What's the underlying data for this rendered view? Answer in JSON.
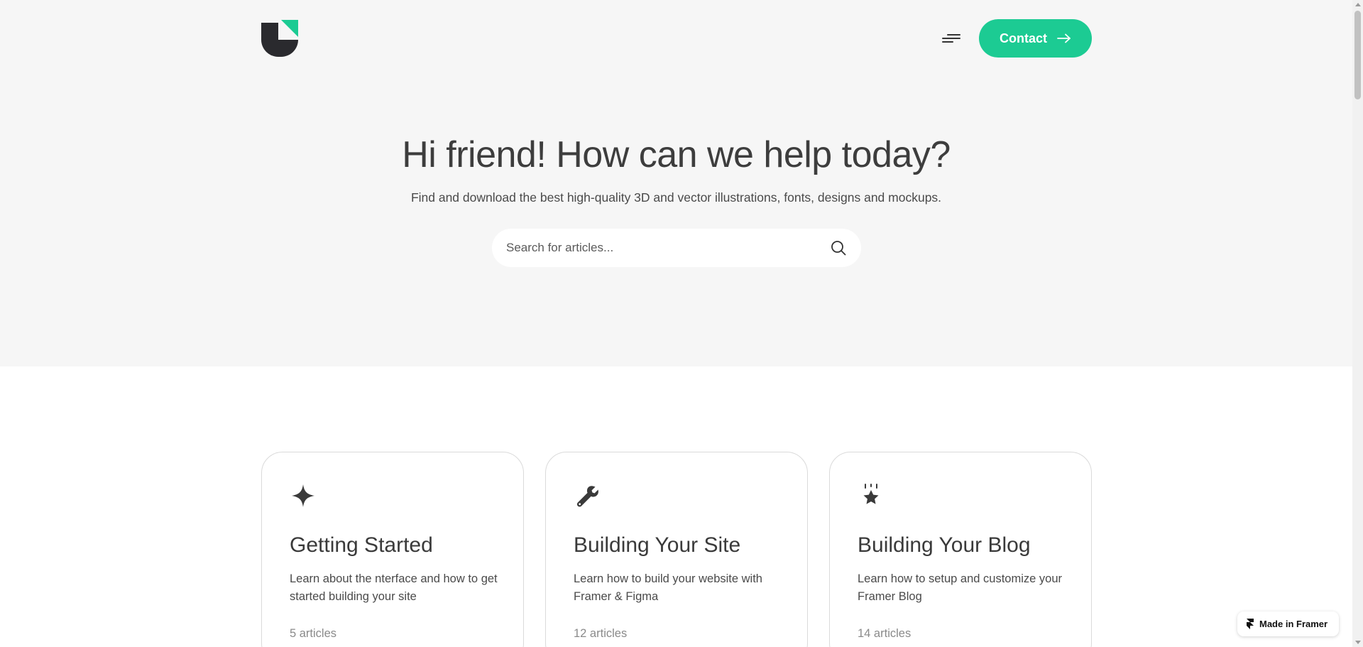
{
  "header": {
    "logo_name": "logo",
    "menu_icon": "menu-icon",
    "contact_label": "Contact",
    "contact_icon": "arrow-right-icon"
  },
  "hero": {
    "title": "Hi friend! How can we help today?",
    "subtitle": "Find and download the best high-quality 3D and vector illustrations, fonts, designs and mockups.",
    "search": {
      "placeholder": "Search for articles...",
      "value": "",
      "icon": "search-icon"
    }
  },
  "cards": [
    {
      "icon": "sparkle-icon",
      "title": "Getting Started",
      "description": "Learn about the nterface and how to get started building your site",
      "count": "5 articles"
    },
    {
      "icon": "wrench-icon",
      "title": "Building Your Site",
      "description": "Learn how to build your website with Framer & Figma",
      "count": "12 articles"
    },
    {
      "icon": "star-icon",
      "title": "Building Your Blog",
      "description": "Learn how to setup and customize your Framer  Blog",
      "count": "14 articles"
    }
  ],
  "badge": {
    "label": "Made in Framer",
    "icon": "framer-icon"
  },
  "colors": {
    "accent": "#1ccb93",
    "hero_bg": "#f6f6f6",
    "text": "#3a3a3a",
    "muted": "#8a8a8a"
  }
}
